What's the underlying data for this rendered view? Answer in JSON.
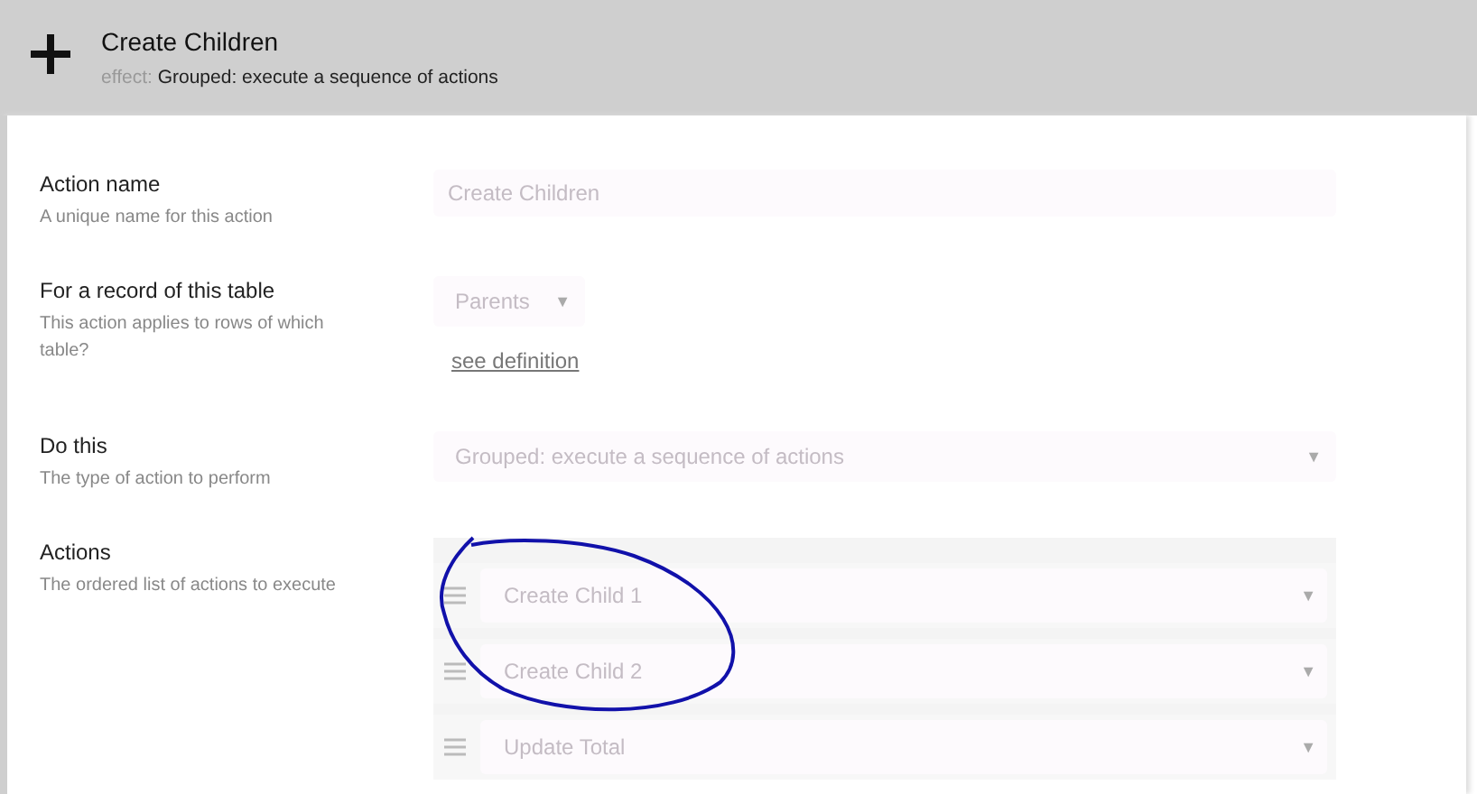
{
  "header": {
    "title": "Create Children",
    "effect_label": "effect:",
    "effect": "Grouped: execute a sequence of actions"
  },
  "fields": [
    {
      "kind": "text",
      "label": "Action name",
      "hint": "A unique name for this action",
      "value": "Create Children"
    },
    {
      "kind": "short-select",
      "label": "For a record of this table",
      "hint": "This action applies to rows of which table?",
      "value": "Parents",
      "arrow": "▼",
      "link": "see definition"
    },
    {
      "kind": "select",
      "label": "Do this",
      "hint": "The type of action to perform",
      "value": "Grouped: execute a sequence of actions",
      "arrow": "▼"
    },
    {
      "kind": "list",
      "label": "Actions",
      "hint": "The ordered list of actions to execute",
      "items": [
        {
          "value": "Create Child 1",
          "arrow": "▼"
        },
        {
          "value": "Create Child 2",
          "arrow": "▼"
        },
        {
          "value": "Update Total",
          "arrow": "▼"
        }
      ]
    }
  ]
}
